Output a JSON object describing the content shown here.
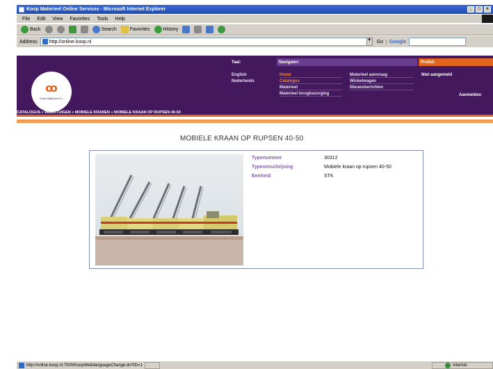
{
  "browser": {
    "title": "Koop Materieel Online Services - Microsoft Internet Explorer",
    "menu": [
      "File",
      "Edit",
      "View",
      "Favorites",
      "Tools",
      "Help"
    ],
    "toolbar": {
      "back": "Back",
      "search": "Search",
      "favorites": "Favorites",
      "history": "History"
    },
    "address_label": "Address",
    "address_value": "http://online.koop.nl",
    "go_label": "Go",
    "google_label": "Google",
    "status_url": "http://online.koop.nl:7000/KoopWeb/languageChange.do?ID=1",
    "status_zone": "Internet"
  },
  "site": {
    "logo_text": "Koop Materieel b.v.",
    "columns": {
      "taal": "Taal:",
      "navigator": "Navigator:",
      "profiel": "Profiel:"
    },
    "languages": [
      "English",
      "Nederlands"
    ],
    "nav_col1": [
      "Home",
      "Catalogus",
      "Materieel",
      "Materieel terugbezorging"
    ],
    "nav_col2": [
      "Materieel aanvraag",
      "Winkelwagen",
      "Nieuwsberichten"
    ],
    "profile_status": "Niet aangemeld",
    "login_label": "Aanmelden",
    "breadcrumb": "CATALOGUS » WERKTUIGEN » MOBIELE KRANEN » MOBIELE KRAAN OP RUPSEN 40-50"
  },
  "product": {
    "title": "MOBIELE KRAAN OP RUPSEN 40-50",
    "details": [
      {
        "label": "Typenummer",
        "value": "30312"
      },
      {
        "label": "Typeomschrijving",
        "value": "Mobiele kraan op rupsen 40-50"
      },
      {
        "label": "Eenheid",
        "value": "STK"
      }
    ]
  },
  "colors": {
    "header_purple": "#43185c",
    "accent_orange": "#e2651e",
    "label_purple": "#8060a8"
  }
}
